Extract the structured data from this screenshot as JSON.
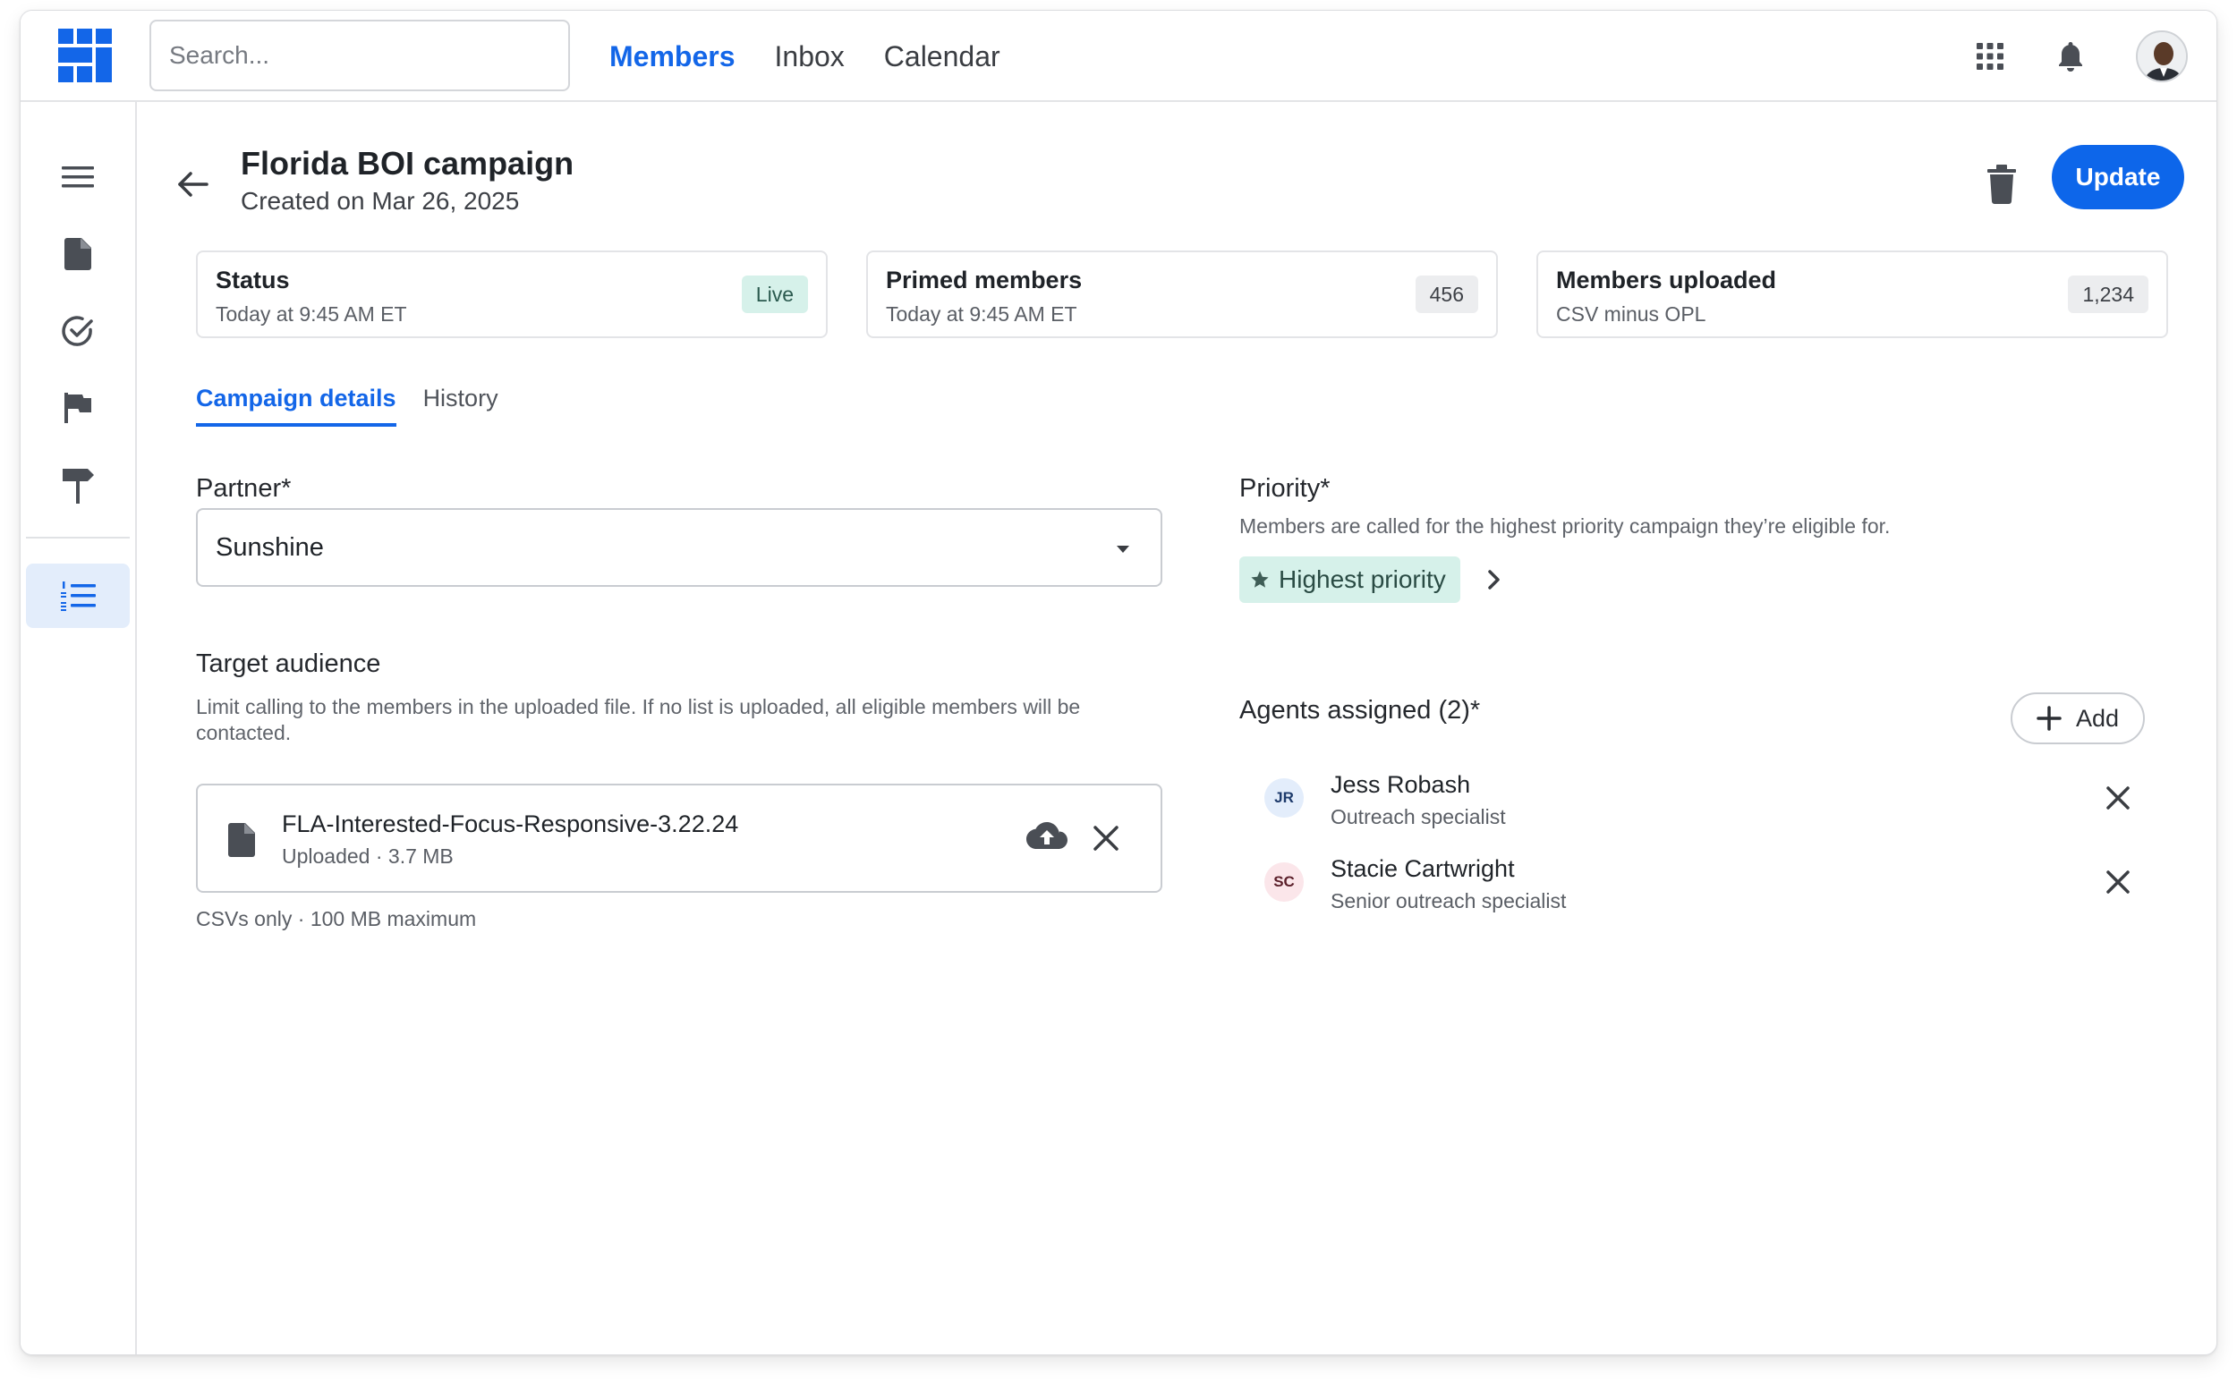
{
  "colors": {
    "accent": "#0d66ea",
    "live_badge_bg": "#d6f1ea",
    "priority_chip_bg": "#d6f1ea",
    "sidebar_active_bg": "#e3edfb"
  },
  "nav": {
    "search_placeholder": "Search...",
    "links": [
      "Members",
      "Inbox",
      "Calendar"
    ],
    "active_link": "Members",
    "icons": [
      "apps-grid-icon",
      "bell-icon",
      "user-avatar"
    ]
  },
  "sidebar": {
    "icons": [
      "menu-icon",
      "document-icon",
      "check-circle-icon",
      "flag-icon",
      "signpost-icon",
      "numbered-list-icon"
    ],
    "active": "numbered-list-icon"
  },
  "header": {
    "title": "Florida BOI campaign",
    "subtitle": "Created on Mar 26, 2025",
    "update_label": "Update"
  },
  "cards": [
    {
      "title": "Status",
      "subtitle": "Today at 9:45 AM ET",
      "badge": "Live"
    },
    {
      "title": "Primed members",
      "subtitle": "Today at 9:45 AM ET",
      "badge": "456"
    },
    {
      "title": "Members uploaded",
      "subtitle": "CSV minus OPL",
      "badge": "1,234"
    }
  ],
  "tabs": {
    "items": [
      "Campaign details",
      "History"
    ],
    "active": "Campaign details"
  },
  "partner": {
    "label": "Partner*",
    "value": "Sunshine"
  },
  "audience": {
    "label": "Target audience",
    "help": "Limit calling to the members in the uploaded file. If no list is uploaded, all eligible members will be contacted.",
    "file_name": "FLA-Interested-Focus-Responsive-3.22.24",
    "file_meta": "Uploaded · 3.7 MB",
    "note": "CSVs only · 100 MB maximum"
  },
  "priority": {
    "label": "Priority*",
    "help": "Members are called for the highest priority campaign they’re eligible for.",
    "chip": "Highest priority"
  },
  "agents": {
    "label": "Agents assigned (2)*",
    "add_label": "Add",
    "items": [
      {
        "initials": "JR",
        "name": "Jess Robash",
        "role": "Outreach specialist",
        "bg": "#e3edfb",
        "fg": "#1d3a6b"
      },
      {
        "initials": "SC",
        "name": "Stacie Cartwright",
        "role": "Senior outreach specialist",
        "bg": "#fbe6ea",
        "fg": "#5b1f2a"
      }
    ]
  }
}
